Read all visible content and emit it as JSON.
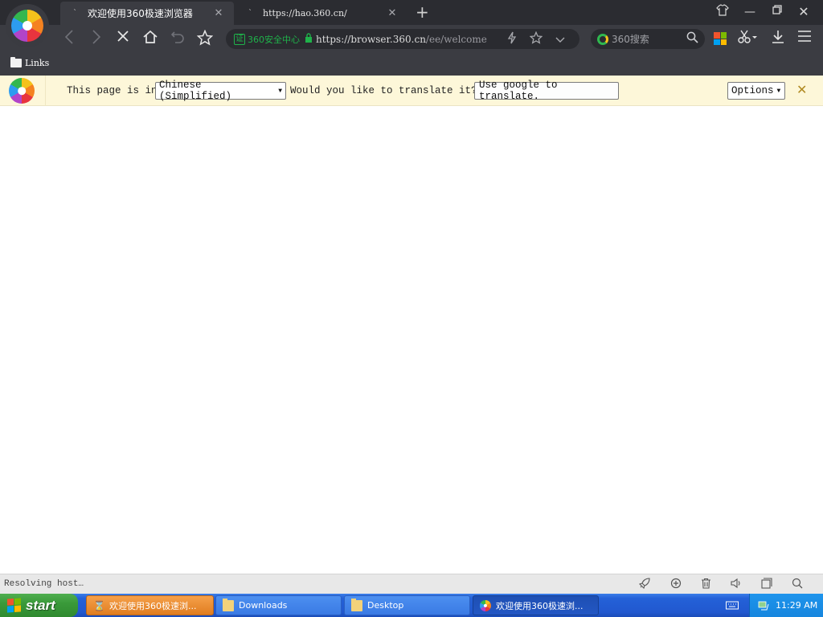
{
  "browser": {
    "tabs": [
      {
        "title": "欢迎使用360极速浏览器",
        "active": true
      },
      {
        "title": "https://hao.360.cn/",
        "active": false
      }
    ],
    "toolbar": {
      "cert_label": "360安全中心",
      "cert_badge": "证",
      "url_main": "https://browser.360.cn",
      "url_rest": "/ee/welcome",
      "search_placeholder": "360搜索"
    },
    "bookmarks": [
      {
        "label": "Links"
      }
    ]
  },
  "translate_bar": {
    "prefix": "This page is in",
    "language": "Chinese (Simplified)",
    "question": "Would you like to translate it?",
    "translate_button": "Use google to translate.",
    "options_button": "Options"
  },
  "status": {
    "text": "Resolving host…"
  },
  "taskbar": {
    "start_label": "start",
    "tasks": [
      {
        "label": "欢迎使用360极速浏...",
        "state": "highlight"
      },
      {
        "label": "Downloads",
        "state": "normal"
      },
      {
        "label": "Desktop",
        "state": "normal"
      },
      {
        "label": "欢迎使用360极速浏...",
        "state": "pressed"
      }
    ],
    "clock": "11:29 AM"
  },
  "colors": {
    "tab_bar": "#2b2c31",
    "toolbar": "#3b3c42",
    "secure_green": "#1fb24a",
    "translate_bar": "#fdf7d9",
    "taskbar_blue": "#2461d8",
    "start_green": "#3a9a3a"
  },
  "icons": {
    "back": "arrow-left-icon",
    "forward": "arrow-right-icon",
    "stop": "close-icon",
    "home": "home-icon",
    "undo": "undo-icon",
    "bookmark": "star-icon",
    "lightning": "lightning-icon",
    "scissors": "scissors-icon",
    "download": "download-icon",
    "menu": "menu-icon"
  }
}
